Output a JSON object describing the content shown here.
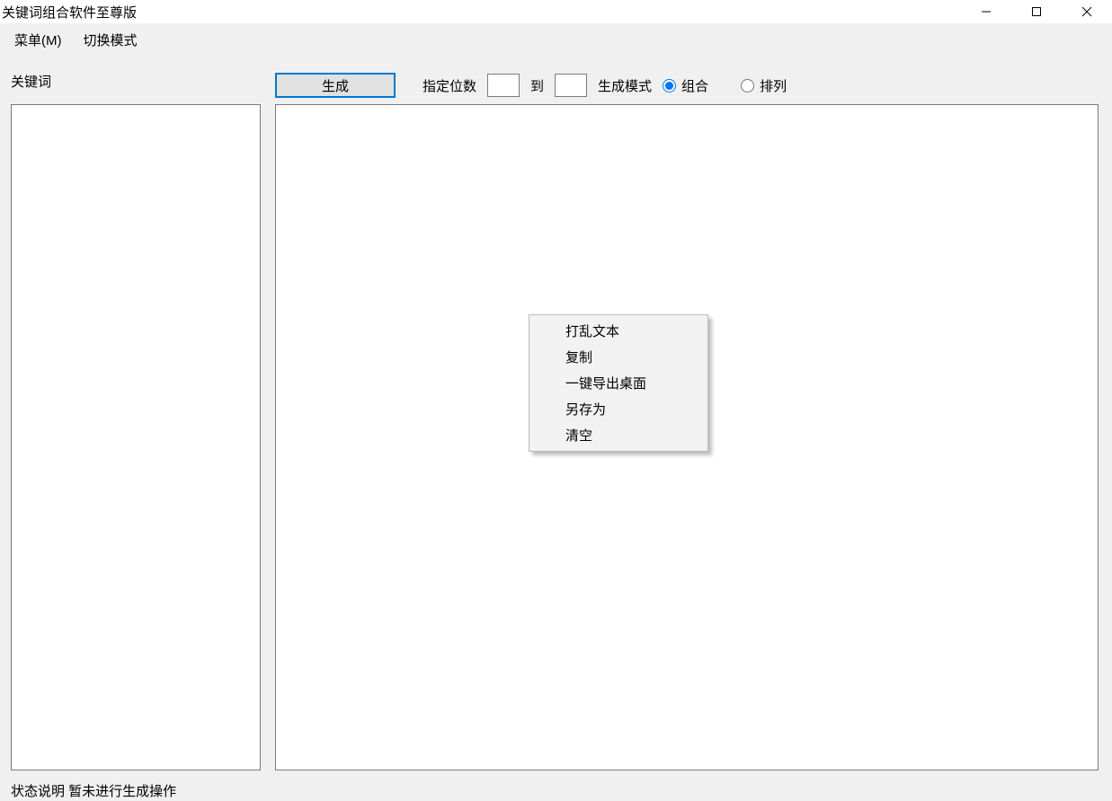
{
  "window": {
    "title": "关键词组合软件至尊版"
  },
  "menubar": {
    "menu": "菜单(M)",
    "switch_mode": "切换模式"
  },
  "left_panel": {
    "label": "关键词",
    "value": ""
  },
  "toolbar": {
    "generate": "生成",
    "digits_label": "指定位数",
    "digits_from": "",
    "to_label": "到",
    "digits_to": "",
    "mode_label": "生成模式",
    "radio_combine": "组合",
    "radio_permute": "排列",
    "selected_mode": "combine"
  },
  "right_panel": {
    "value": ""
  },
  "context_menu": {
    "items": [
      "打乱文本",
      "复制",
      "一键导出桌面",
      "另存为",
      "清空"
    ]
  },
  "statusbar": {
    "text": "状态说明  暂未进行生成操作"
  }
}
